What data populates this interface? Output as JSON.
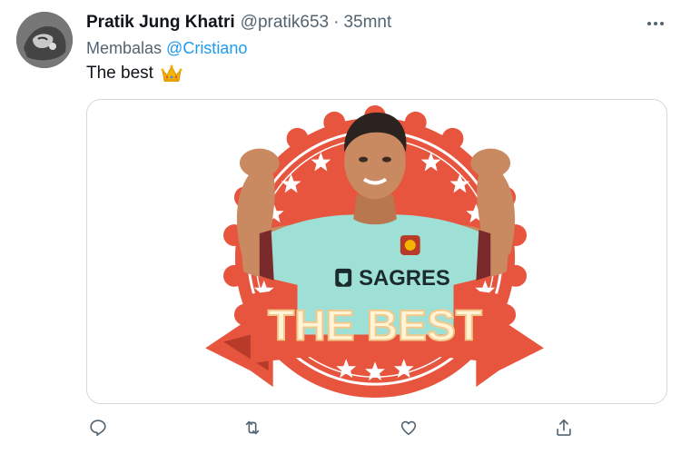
{
  "tweet": {
    "author_name": "Pratik Jung Khatri",
    "author_handle": "@pratik653",
    "separator": "·",
    "time": "35mnt",
    "reply_prefix": "Membalas",
    "reply_mention": "@Cristiano",
    "text": "The best",
    "emoji_icon": "crown-icon"
  },
  "media": {
    "banner_text": "THE BEST",
    "jersey_text": "SAGRES",
    "colors": {
      "badge_red": "#e8553e",
      "jersey": "#9fe0d6",
      "skin": "#c98a62",
      "hair": "#2a2320"
    }
  },
  "actions": [
    {
      "icon": "reply-icon"
    },
    {
      "icon": "retweet-icon"
    },
    {
      "icon": "like-icon"
    },
    {
      "icon": "share-icon"
    }
  ],
  "colors": {
    "text_primary": "#0f1419",
    "text_secondary": "#536471",
    "link": "#1d9bf0",
    "border": "#cfd9de"
  }
}
